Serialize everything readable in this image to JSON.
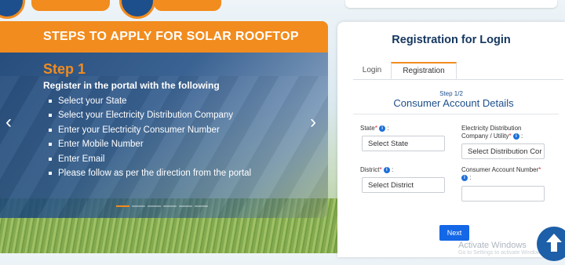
{
  "carousel": {
    "header_title": "STEPS TO APPLY FOR SOLAR ROOFTOP",
    "step_title": "Step 1",
    "step_subtitle": "Register in the portal with the following",
    "step_items": [
      "Select your State",
      "Select your Electricity Distribution Company",
      "Enter your Electricity Consumer Number",
      "Enter Mobile Number",
      "Enter Email",
      "Please follow as per the direction from the portal"
    ],
    "prev_glyph": "‹",
    "next_glyph": "›",
    "indicator_count": 6,
    "active_indicator": 1
  },
  "form": {
    "title": "Registration for Login",
    "tabs": [
      {
        "label": "Login",
        "active": false
      },
      {
        "label": "Registration",
        "active": true
      }
    ],
    "step_indicator": "Step 1/2",
    "section_title": "Consumer Account Details",
    "state": {
      "label": "State",
      "required": "*",
      "colon": " :",
      "value": "Select State"
    },
    "discom": {
      "label_line1": "Electricity Distribution",
      "label_line2": "Company / Utility",
      "required": "*",
      "colon": " :",
      "value": "Select Distribution Cor"
    },
    "district": {
      "label": "District",
      "required": "*",
      "colon": " :",
      "value": "Select District"
    },
    "consumer": {
      "label": "Consumer Account Number",
      "required": "*",
      "colon": " :",
      "value": ""
    },
    "info_glyph": "i",
    "next_label": "Next"
  },
  "overlay": {
    "watermark": "Activate Windows",
    "watermark_sub": "Go to Settings to activate Windows.",
    "scroll_top_icon": "arrow-up-icon"
  },
  "colors": {
    "accent_orange": "#f28c1e",
    "brand_navy": "#14365f",
    "primary_blue": "#1467e6",
    "required_red": "#e0202a"
  }
}
